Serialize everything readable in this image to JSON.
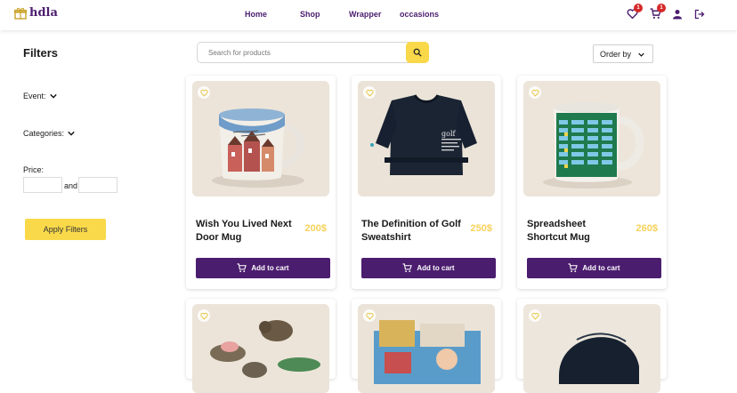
{
  "header": {
    "logo_text": "hdla",
    "nav": [
      "Home",
      "Shop",
      "Wrapper",
      "occasions"
    ],
    "wishlist_count": "1",
    "cart_count": "1"
  },
  "filters": {
    "title": "Filters",
    "event_label": "Event:",
    "categories_label": "Categories:",
    "price_label": "Price:",
    "and_label": "and",
    "apply_label": "Apply Filters"
  },
  "search": {
    "placeholder": "Search for products"
  },
  "order": {
    "label": "Order by"
  },
  "products": [
    {
      "name": "Wish You Lived Next Door Mug",
      "price": "200$",
      "button": "Add to cart"
    },
    {
      "name": "The Definition of Golf Sweatshirt",
      "price": "250$",
      "button": "Add to cart"
    },
    {
      "name": "Spreadsheet Shortcut Mug",
      "price": "260$",
      "button": "Add to cart"
    }
  ],
  "sweatshirt_print": "golf",
  "colors": {
    "brand": "#4b1d6e",
    "accent": "#f9d94a",
    "price": "#f7d15a",
    "badge": "#d62828"
  }
}
